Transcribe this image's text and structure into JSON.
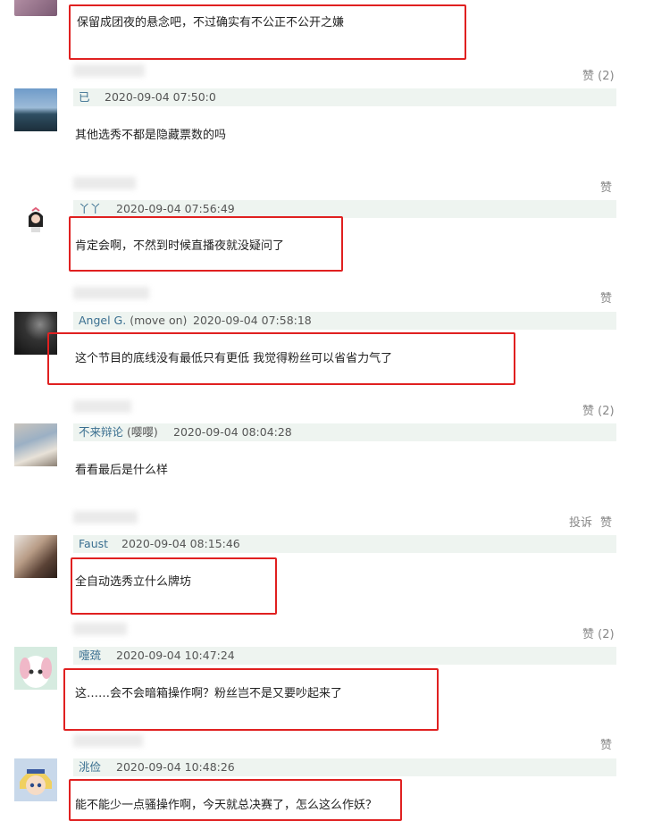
{
  "accent": {
    "name_color": "#3a6f90",
    "highlight_border": "#e02020",
    "meta_bg": "#eef4f0"
  },
  "comments": [
    {
      "text": "保留成团夜的悬念吧，不过确实有不公正不公开之嫌"
    },
    {
      "like": "赞 (2)",
      "name": "已",
      "time": "2020-09-04 07:50:0",
      "text": "其他选秀不都是隐藏票数的吗"
    },
    {
      "like": "赞",
      "name": "丫丫",
      "time": "2020-09-04 07:56:49",
      "text": "肯定会啊，不然到时候直播夜就没疑问了"
    },
    {
      "like": "赞",
      "name": "Angel G.",
      "sub": "(move on)",
      "time": "2020-09-04 07:58:18",
      "text": "这个节目的底线没有最低只有更低 我觉得粉丝可以省省力气了"
    },
    {
      "like": "赞 (2)",
      "name": "不来辩论",
      "sub": "(嘤嘤)",
      "time": "2020-09-04 08:04:28",
      "text": "看看最后是什么样"
    },
    {
      "like": "赞",
      "report": "投诉",
      "name": "Faust",
      "time": "2020-09-04 08:15:46",
      "text": "全自动选秀立什么牌坊"
    },
    {
      "like": "赞 (2)",
      "name": "嚏巯",
      "time": "2020-09-04 10:47:24",
      "text": "这……会不会暗箱操作啊？粉丝岂不是又要吵起来了"
    },
    {
      "like": "赞",
      "name": "洮俭",
      "time": "2020-09-04 10:48:26",
      "text": "能不能少一点骚操作啊，今天就总决赛了，怎么这么作妖？"
    }
  ]
}
